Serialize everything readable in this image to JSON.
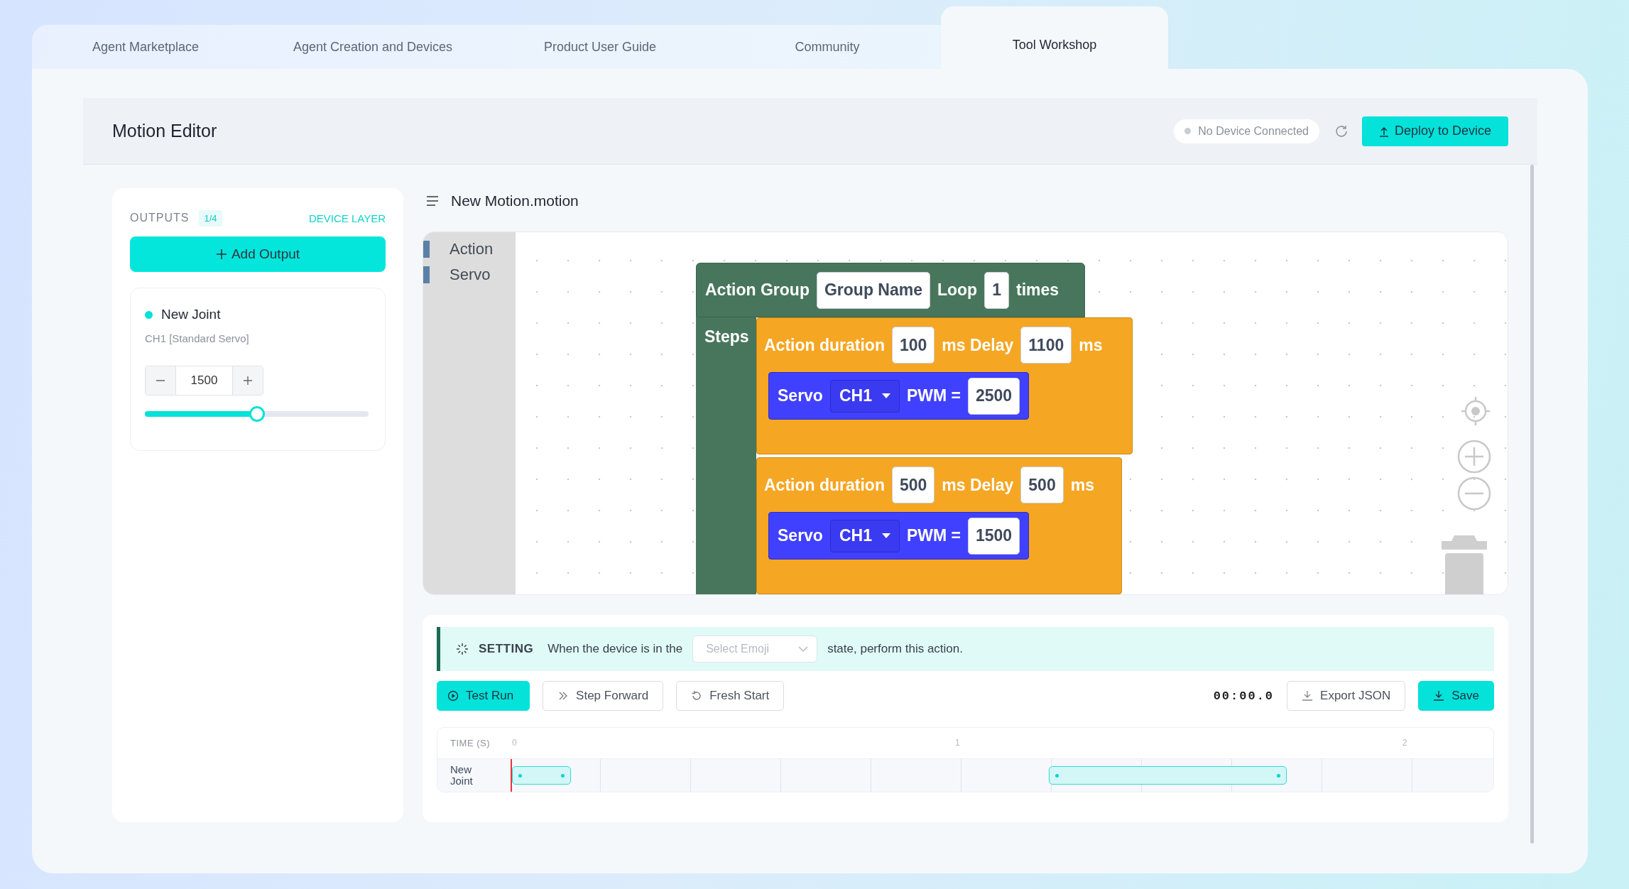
{
  "tabs": [
    {
      "label": "Agent Marketplace",
      "selected": false
    },
    {
      "label": "Agent Creation and Devices",
      "selected": false
    },
    {
      "label": "Product User Guide",
      "selected": false
    },
    {
      "label": "Community",
      "selected": false
    },
    {
      "label": "Tool Workshop",
      "selected": true
    }
  ],
  "editor": {
    "title": "Motion Editor",
    "device_status": "No Device Connected",
    "deploy_button": "Deploy to Device"
  },
  "outputs": {
    "title": "OUTPUTS",
    "count": "1/4",
    "layer_link": "DEVICE LAYER",
    "add_button": "Add Output",
    "joints": [
      {
        "name": "New Joint",
        "channel": "CH1 [Standard Servo]",
        "value": "1500",
        "level": 0.5
      }
    ]
  },
  "file": {
    "name": "New Motion.motion"
  },
  "toolbox": [
    "Action",
    "Servo"
  ],
  "action_group": {
    "label": "Action Group",
    "name": "Group Name",
    "loop_label": "Loop",
    "loop": "1",
    "times_label": "times",
    "steps_label": "Steps",
    "steps": [
      {
        "duration_label": "Action duration",
        "duration": "100",
        "delay_label": "ms Delay",
        "delay": "1100",
        "unit": "ms",
        "servos": [
          {
            "label": "Servo",
            "channel": "CH1",
            "pwm_label": "PWM =",
            "pwm": "2500"
          }
        ]
      },
      {
        "duration_label": "Action duration",
        "duration": "500",
        "delay_label": "ms Delay",
        "delay": "500",
        "unit": "ms",
        "servos": [
          {
            "label": "Servo",
            "channel": "CH1",
            "pwm_label": "PWM =",
            "pwm": "1500"
          }
        ]
      }
    ]
  },
  "setting": {
    "label": "SETTING",
    "before": "When the device is in the",
    "select_placeholder": "Select Emoji",
    "after": "state, perform this action."
  },
  "controls": {
    "test_run": "Test Run",
    "step_forward": "Step Forward",
    "fresh_start": "Fresh Start",
    "time": "00:00.0",
    "export": "Export JSON",
    "save": "Save"
  },
  "timeline": {
    "header": "TIME (S)",
    "ticks": [
      "0",
      "1",
      "2"
    ],
    "tracks": [
      {
        "name": "New Joint"
      }
    ]
  }
}
